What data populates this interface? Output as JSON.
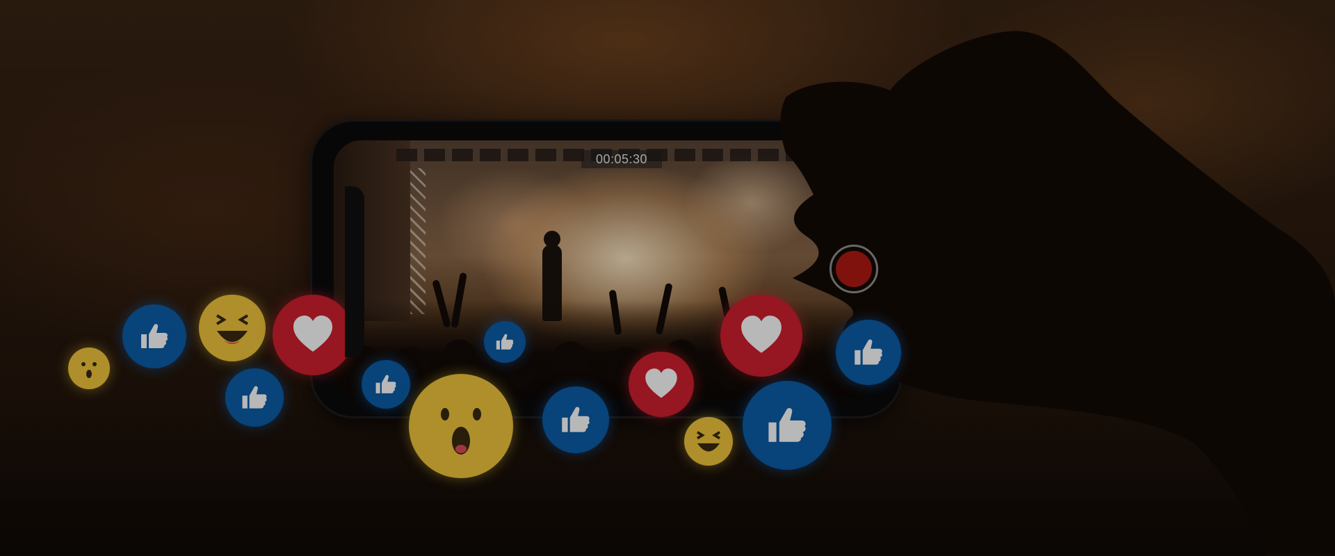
{
  "video": {
    "timer": "00:05:30",
    "recording": true
  },
  "reactions": [
    {
      "type": "wow",
      "icon": "wow-emoji-icon"
    },
    {
      "type": "like",
      "icon": "thumbs-up-icon"
    },
    {
      "type": "haha",
      "icon": "laughing-emoji-icon"
    },
    {
      "type": "love",
      "icon": "heart-icon"
    },
    {
      "type": "like",
      "icon": "thumbs-up-icon"
    },
    {
      "type": "like",
      "icon": "thumbs-up-icon"
    },
    {
      "type": "like",
      "icon": "thumbs-up-icon"
    },
    {
      "type": "wow",
      "icon": "wow-emoji-icon"
    },
    {
      "type": "like",
      "icon": "thumbs-up-icon"
    },
    {
      "type": "love",
      "icon": "heart-icon"
    },
    {
      "type": "love",
      "icon": "heart-icon"
    },
    {
      "type": "haha",
      "icon": "laughing-emoji-icon"
    },
    {
      "type": "like",
      "icon": "thumbs-up-icon"
    },
    {
      "type": "like",
      "icon": "thumbs-up-icon"
    }
  ],
  "colors": {
    "like": "#0c5ea8",
    "love": "#d01f2e",
    "emoji": "#f2c63c",
    "record": "#b21a12"
  }
}
